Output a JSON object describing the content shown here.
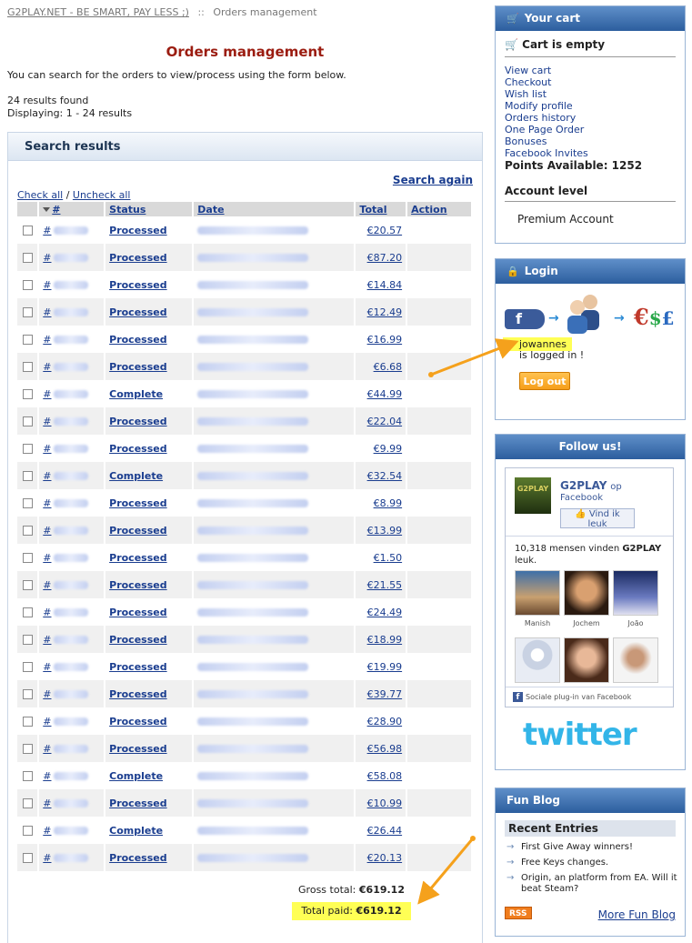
{
  "breadcrumb": {
    "home": "G2PLAY.NET - BE SMART, PAY LESS ;)",
    "separator": "::",
    "current": "Orders management"
  },
  "page": {
    "title": "Orders management",
    "intro": "You can search for the orders to view/process using the form below.",
    "results_found": "24 results found",
    "displaying": "Displaying: 1 - 24 results"
  },
  "results": {
    "heading": "Search results",
    "search_again": "Search again",
    "check_all": "Check all",
    "uncheck_all": "Uncheck all",
    "columns": {
      "id": "#",
      "status": "Status",
      "date": "Date",
      "total": "Total",
      "action": "Action"
    },
    "orders": [
      {
        "status": "Processed",
        "total": "€20.57"
      },
      {
        "status": "Processed",
        "total": "€87.20"
      },
      {
        "status": "Processed",
        "total": "€14.84"
      },
      {
        "status": "Processed",
        "total": "€12.49"
      },
      {
        "status": "Processed",
        "total": "€16.99"
      },
      {
        "status": "Processed",
        "total": "€6.68"
      },
      {
        "status": "Complete",
        "total": "€44.99"
      },
      {
        "status": "Processed",
        "total": "€22.04"
      },
      {
        "status": "Processed",
        "total": "€9.99"
      },
      {
        "status": "Complete",
        "total": "€32.54"
      },
      {
        "status": "Processed",
        "total": "€8.99"
      },
      {
        "status": "Processed",
        "total": "€13.99"
      },
      {
        "status": "Processed",
        "total": "€1.50"
      },
      {
        "status": "Processed",
        "total": "€21.55"
      },
      {
        "status": "Processed",
        "total": "€24.49"
      },
      {
        "status": "Processed",
        "total": "€18.99"
      },
      {
        "status": "Processed",
        "total": "€19.99"
      },
      {
        "status": "Processed",
        "total": "€39.77"
      },
      {
        "status": "Processed",
        "total": "€28.90"
      },
      {
        "status": "Processed",
        "total": "€56.98"
      },
      {
        "status": "Complete",
        "total": "€58.08"
      },
      {
        "status": "Processed",
        "total": "€10.99"
      },
      {
        "status": "Complete",
        "total": "€26.44"
      },
      {
        "status": "Processed",
        "total": "€20.13"
      }
    ],
    "gross_label": "Gross total:",
    "gross_value": "€619.12",
    "paid_label": "Total paid:",
    "paid_value": "€619.12"
  },
  "cart": {
    "heading": "Your cart",
    "empty": "Cart is empty",
    "links": [
      "View cart",
      "Checkout",
      "Wish list",
      "Modify profile",
      "Orders history",
      "One Page Order",
      "Bonuses",
      "Facebook Invites"
    ],
    "points": "Points Available: 1252",
    "account_level_title": "Account level",
    "account_level_value": "Premium Account"
  },
  "login": {
    "heading": "Login",
    "username": "jowannes",
    "logged_in": "is logged in !",
    "logout": "Log out"
  },
  "follow": {
    "heading": "Follow us!",
    "page_name": "G2PLAY",
    "op": "op",
    "platform": "Facebook",
    "like": "Vind ik leuk",
    "fans_count": "10,318 mensen vinden",
    "fans_page": "G2PLAY",
    "fans_suffix": "leuk.",
    "friends": [
      "Manish",
      "Jochem",
      "João"
    ],
    "plugin": "Sociale plug-in van Facebook",
    "twitter": "twitter"
  },
  "blog": {
    "heading": "Fun Blog",
    "recent": "Recent Entries",
    "entries": [
      "First Give Away winners!",
      "Free Keys changes.",
      "Origin, an platform from EA. Will it beat Steam?"
    ],
    "rss": "RSS",
    "more": "More Fun Blog"
  },
  "colors": {
    "accent": "#2c5e9e",
    "title": "#9b1c10",
    "highlight": "#ffff55",
    "arrow": "#f5a11c",
    "logout": "#f69e1a"
  }
}
